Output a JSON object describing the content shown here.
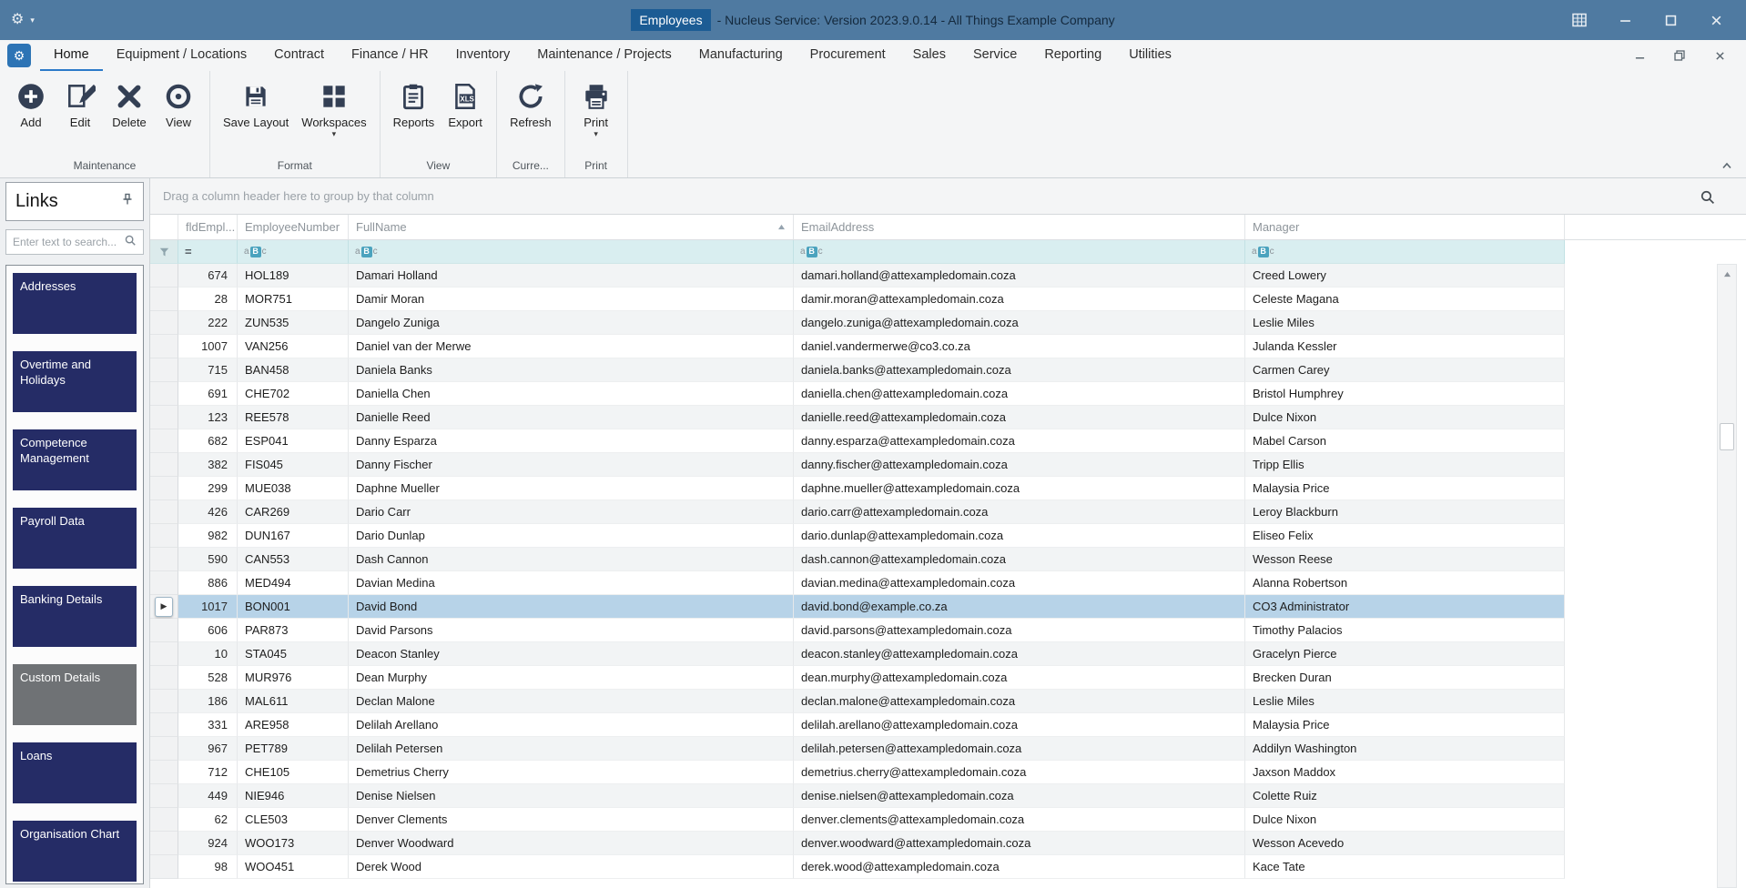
{
  "titlebar": {
    "badge": "Employees",
    "title": "- Nucleus Service: Version 2023.9.0.14 - All Things Example Company"
  },
  "colors": {
    "titlebar": "#4f7aa1",
    "badge": "#1c5c94",
    "accent": "#2c7ac9",
    "icon": "#333f54",
    "sidebar_button": "#252c66",
    "sidebar_button_gray": "#6f7275",
    "filter_row": "#d9eef0",
    "selected_row": "#b7d3e8"
  },
  "ribbon": {
    "active_tab": 0,
    "tabs": [
      "Home",
      "Equipment / Locations",
      "Contract",
      "Finance / HR",
      "Inventory",
      "Maintenance / Projects",
      "Manufacturing",
      "Procurement",
      "Sales",
      "Service",
      "Reporting",
      "Utilities"
    ],
    "groups": [
      {
        "label": "Maintenance",
        "buttons": [
          {
            "label": "Add",
            "icon": "add"
          },
          {
            "label": "Edit",
            "icon": "edit"
          },
          {
            "label": "Delete",
            "icon": "delete"
          },
          {
            "label": "View",
            "icon": "view"
          }
        ]
      },
      {
        "label": "Format",
        "buttons": [
          {
            "label": "Save Layout",
            "icon": "save-layout"
          },
          {
            "label": "Workspaces",
            "icon": "workspaces",
            "dropdown": true
          }
        ]
      },
      {
        "label": "View",
        "buttons": [
          {
            "label": "Reports",
            "icon": "reports"
          },
          {
            "label": "Export",
            "icon": "export-xls"
          }
        ]
      },
      {
        "label": "Curre...",
        "buttons": [
          {
            "label": "Refresh",
            "icon": "refresh"
          }
        ]
      },
      {
        "label": "Print",
        "buttons": [
          {
            "label": "Print",
            "icon": "print",
            "dropdown": true
          }
        ]
      }
    ]
  },
  "sidebar": {
    "header": "Links",
    "search_placeholder": "Enter text to search...",
    "items": [
      {
        "label": "Addresses"
      },
      {
        "label": "Overtime and Holidays"
      },
      {
        "label": "Competence Management"
      },
      {
        "label": "Payroll Data"
      },
      {
        "label": "Banking Details"
      },
      {
        "label": "Custom Details",
        "gray": true
      },
      {
        "label": "Loans"
      },
      {
        "label": "Organisation Chart"
      }
    ]
  },
  "grid": {
    "groupby_hint": "Drag a column header here to group by that column",
    "columns": [
      "fldEmpl...",
      "EmployeeNumber",
      "FullName",
      "EmailAddress",
      "Manager"
    ],
    "sorted_column_index": 2,
    "selected_row_index": 14,
    "filter_icons": {
      "numeric": "=",
      "text_parts": [
        "a",
        "B",
        "c"
      ]
    },
    "rows": [
      [
        "674",
        "HOL189",
        "Damari Holland",
        "damari.holland@attexampledomain.coza",
        "Creed Lowery"
      ],
      [
        "28",
        "MOR751",
        "Damir Moran",
        "damir.moran@attexampledomain.coza",
        "Celeste Magana"
      ],
      [
        "222",
        "ZUN535",
        "Dangelo Zuniga",
        "dangelo.zuniga@attexampledomain.coza",
        "Leslie Miles"
      ],
      [
        "1007",
        "VAN256",
        "Daniel van der Merwe",
        "daniel.vandermerwe@co3.co.za",
        "Julanda Kessler"
      ],
      [
        "715",
        "BAN458",
        "Daniela Banks",
        "daniela.banks@attexampledomain.coza",
        "Carmen Carey"
      ],
      [
        "691",
        "CHE702",
        "Daniella Chen",
        "daniella.chen@attexampledomain.coza",
        "Bristol Humphrey"
      ],
      [
        "123",
        "REE578",
        "Danielle Reed",
        "danielle.reed@attexampledomain.coza",
        "Dulce Nixon"
      ],
      [
        "682",
        "ESP041",
        "Danny Esparza",
        "danny.esparza@attexampledomain.coza",
        "Mabel Carson"
      ],
      [
        "382",
        "FIS045",
        "Danny Fischer",
        "danny.fischer@attexampledomain.coza",
        "Tripp Ellis"
      ],
      [
        "299",
        "MUE038",
        "Daphne Mueller",
        "daphne.mueller@attexampledomain.coza",
        "Malaysia Price"
      ],
      [
        "426",
        "CAR269",
        "Dario Carr",
        "dario.carr@attexampledomain.coza",
        "Leroy Blackburn"
      ],
      [
        "982",
        "DUN167",
        "Dario Dunlap",
        "dario.dunlap@attexampledomain.coza",
        "Eliseo Felix"
      ],
      [
        "590",
        "CAN553",
        "Dash Cannon",
        "dash.cannon@attexampledomain.coza",
        "Wesson Reese"
      ],
      [
        "886",
        "MED494",
        "Davian Medina",
        "davian.medina@attexampledomain.coza",
        "Alanna Robertson"
      ],
      [
        "1017",
        "BON001",
        "David Bond",
        "david.bond@example.co.za",
        "CO3 Administrator"
      ],
      [
        "606",
        "PAR873",
        "David Parsons",
        "david.parsons@attexampledomain.coza",
        "Timothy Palacios"
      ],
      [
        "10",
        "STA045",
        "Deacon Stanley",
        "deacon.stanley@attexampledomain.coza",
        "Gracelyn Pierce"
      ],
      [
        "528",
        "MUR976",
        "Dean Murphy",
        "dean.murphy@attexampledomain.coza",
        "Brecken Duran"
      ],
      [
        "186",
        "MAL611",
        "Declan Malone",
        "declan.malone@attexampledomain.coza",
        "Leslie Miles"
      ],
      [
        "331",
        "ARE958",
        "Delilah Arellano",
        "delilah.arellano@attexampledomain.coza",
        "Malaysia Price"
      ],
      [
        "967",
        "PET789",
        "Delilah Petersen",
        "delilah.petersen@attexampledomain.coza",
        "Addilyn Washington"
      ],
      [
        "712",
        "CHE105",
        "Demetrius Cherry",
        "demetrius.cherry@attexampledomain.coza",
        "Jaxson Maddox"
      ],
      [
        "449",
        "NIE946",
        "Denise Nielsen",
        "denise.nielsen@attexampledomain.coza",
        "Colette Ruiz"
      ],
      [
        "62",
        "CLE503",
        "Denver Clements",
        "denver.clements@attexampledomain.coza",
        "Dulce Nixon"
      ],
      [
        "924",
        "WOO173",
        "Denver Woodward",
        "denver.woodward@attexampledomain.coza",
        "Wesson Acevedo"
      ],
      [
        "98",
        "WOO451",
        "Derek Wood",
        "derek.wood@attexampledomain.coza",
        "Kace Tate"
      ]
    ]
  }
}
